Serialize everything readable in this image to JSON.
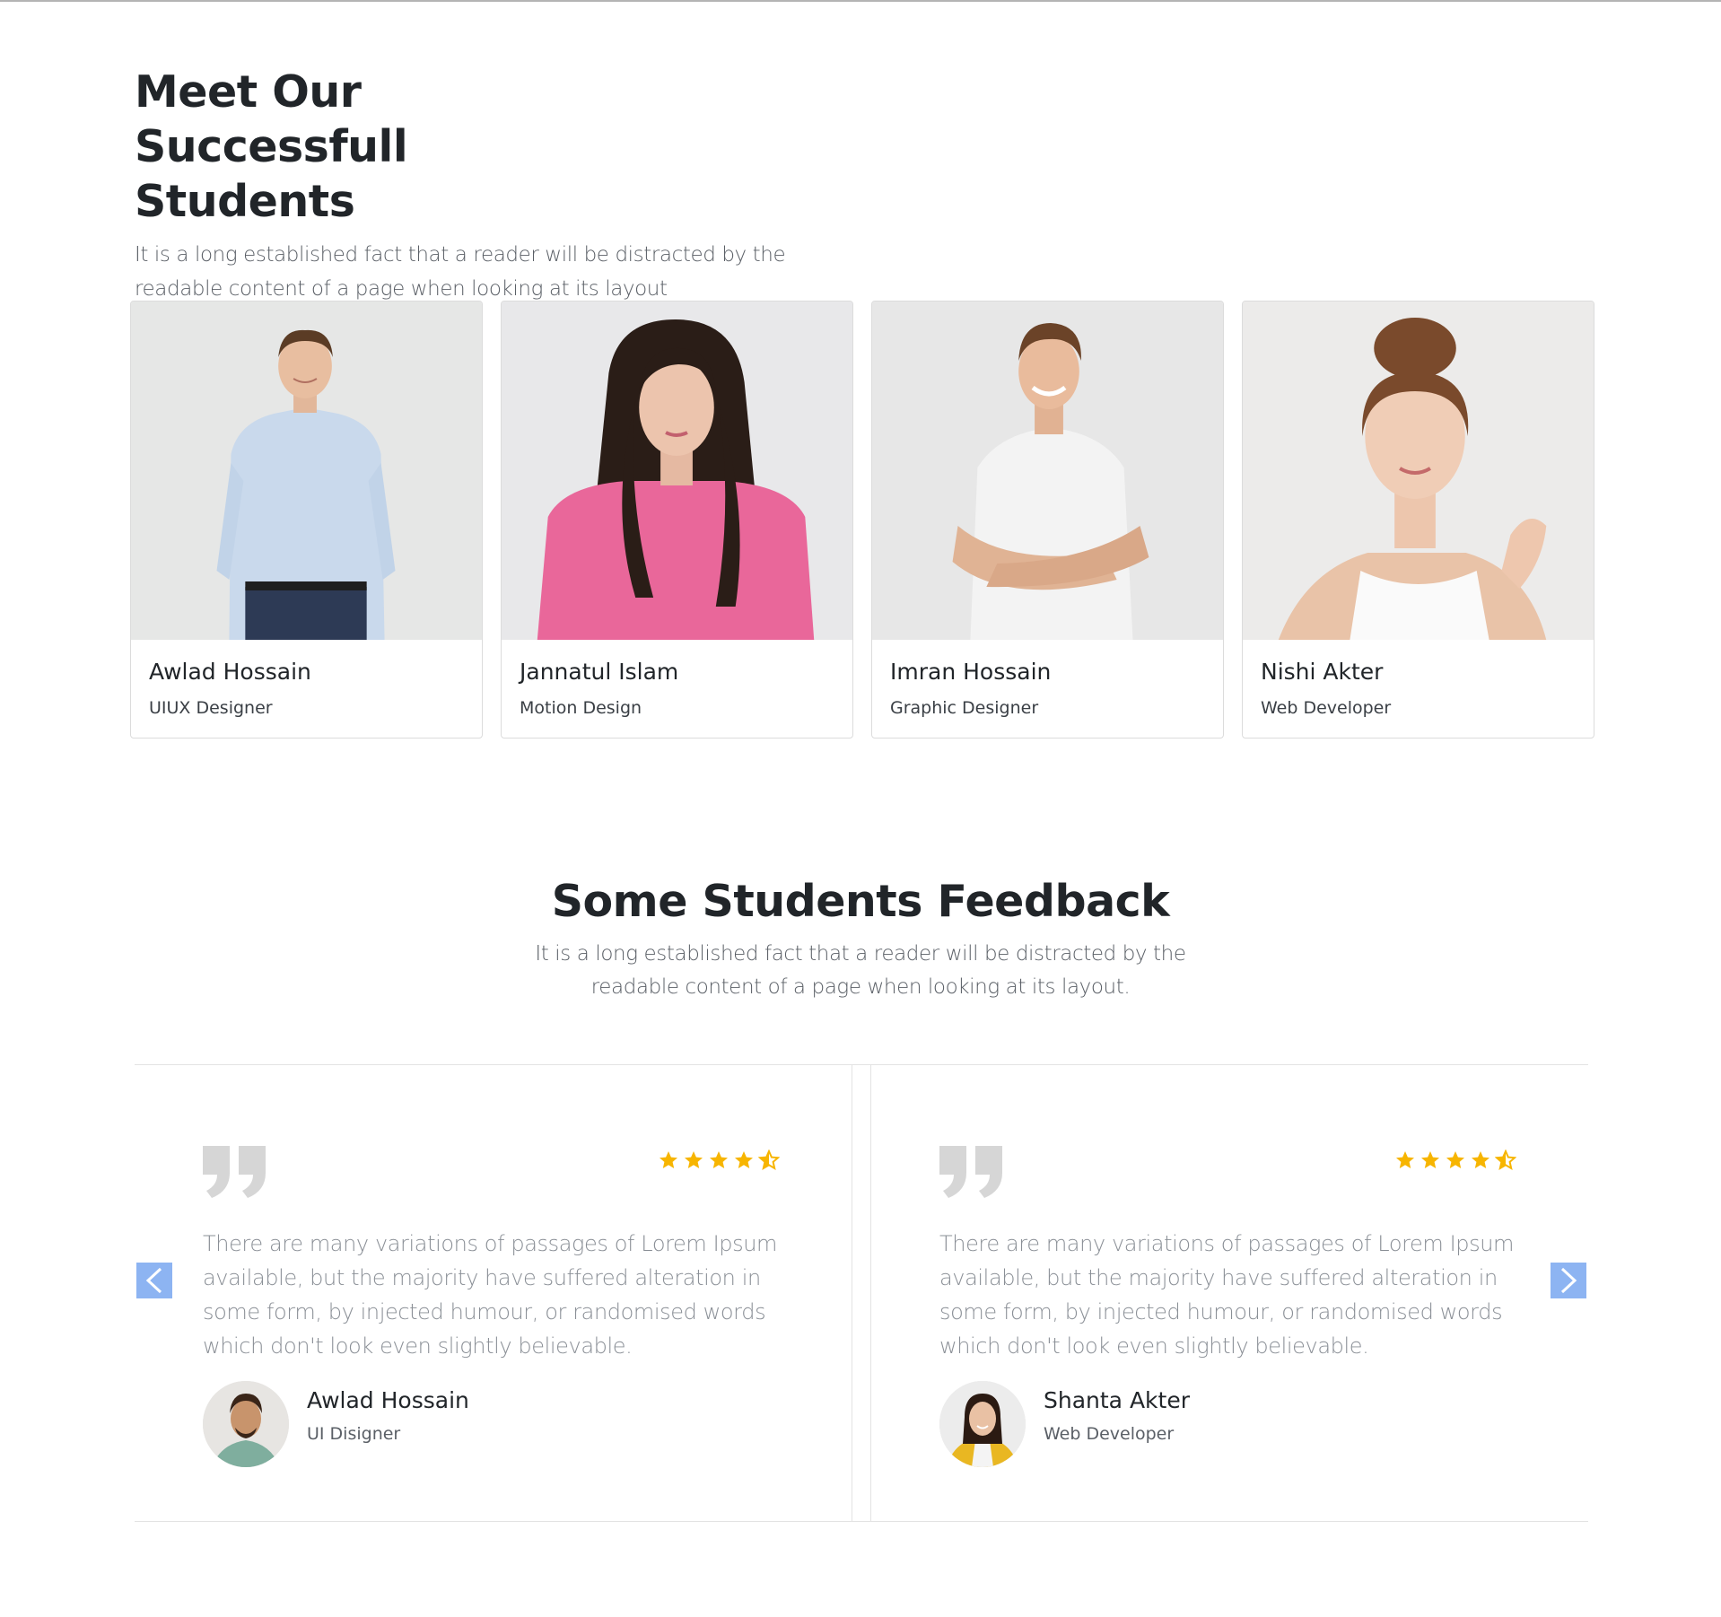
{
  "students_section": {
    "title": "Meet Our Successfull Students",
    "subtitle": "It is a long established fact that a reader will be distracted by the readable content of a page when looking at its layout",
    "students": [
      {
        "name": "Awlad Hossain",
        "role": "UIUX Designer"
      },
      {
        "name": "Jannatul Islam",
        "role": "Motion Design"
      },
      {
        "name": "Imran Hossain",
        "role": "Graphic Designer"
      },
      {
        "name": "Nishi Akter",
        "role": "Web Developer"
      }
    ]
  },
  "feedback_section": {
    "title": "Some Students Feedback",
    "subtitle": "It is a long established fact that a reader will be distracted by the readable content of a page when looking at its layout.",
    "rating_color": "#f7b500",
    "arrow_color": "#8db4f2",
    "prev_icon": "chevron-left-icon",
    "next_icon": "chevron-right-icon",
    "testimonials": [
      {
        "text": "There are many variations of passages of Lorem Ipsum available, but the majority have suffered alteration in some form, by injected humour, or randomised words which don't look even slightly believable.",
        "name": "Awlad Hossain",
        "role": "UI Disigner",
        "rating": 4.5
      },
      {
        "text": "There are many variations of passages of Lorem Ipsum available, but the majority have suffered alteration in some form, by injected humour, or randomised words which don't look even slightly believable.",
        "name": "Shanta Akter",
        "role": "Web Developer",
        "rating": 4.5
      }
    ]
  }
}
